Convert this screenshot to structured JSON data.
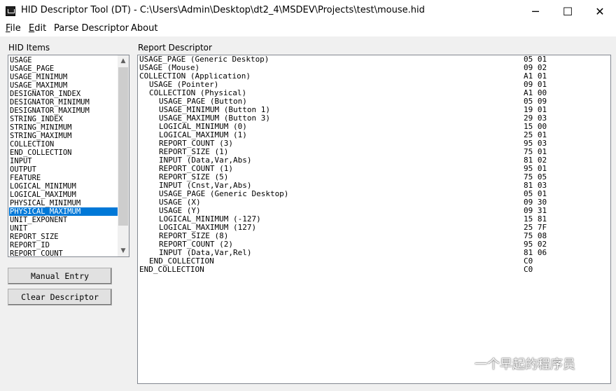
{
  "window": {
    "title": "HID Descriptor Tool (DT) - C:\\Users\\Admin\\Desktop\\dt2_4\\MSDEV\\Projects\\test\\mouse.hid",
    "icon": "app-icon",
    "controls": {
      "minimize": "─",
      "maximize": "☐",
      "close": "✕"
    }
  },
  "menu": [
    {
      "accel": "F",
      "rest": "ile"
    },
    {
      "accel": "E",
      "rest": "dit"
    },
    {
      "accel": "",
      "rest": "Parse Descriptor"
    },
    {
      "accel": "",
      "rest": "About"
    }
  ],
  "hid_items": {
    "label": "HID Items",
    "items": [
      "USAGE",
      "USAGE_PAGE",
      "USAGE_MINIMUM",
      "USAGE_MAXIMUM",
      "DESIGNATOR_INDEX",
      "DESIGNATOR_MINIMUM",
      "DESIGNATOR_MAXIMUM",
      "STRING_INDEX",
      "STRING_MINIMUM",
      "STRING_MAXIMUM",
      "COLLECTION",
      "END_COLLECTION",
      "INPUT",
      "OUTPUT",
      "FEATURE",
      "LOGICAL_MINIMUM",
      "LOGICAL_MAXIMUM",
      "PHYSICAL_MINIMUM",
      "PHYSICAL_MAXIMUM",
      "UNIT_EXPONENT",
      "UNIT",
      "REPORT_SIZE",
      "REPORT_ID",
      "REPORT_COUNT"
    ],
    "selected": "PHYSICAL_MAXIMUM",
    "scroll_up": "▲",
    "scroll_down": "▼"
  },
  "buttons": {
    "manual_entry": "Manual Entry",
    "clear_descriptor": "Clear Descriptor"
  },
  "report": {
    "label": "Report Descriptor",
    "lines": [
      {
        "text": "USAGE_PAGE (Generic Desktop)",
        "indent": 0,
        "hex": "05 01"
      },
      {
        "text": "USAGE (Mouse)",
        "indent": 0,
        "hex": "09 02"
      },
      {
        "text": "COLLECTION (Application)",
        "indent": 0,
        "hex": "A1 01"
      },
      {
        "text": "USAGE (Pointer)",
        "indent": 1,
        "hex": "09 01"
      },
      {
        "text": "COLLECTION (Physical)",
        "indent": 1,
        "hex": "A1 00"
      },
      {
        "text": "USAGE_PAGE (Button)",
        "indent": 2,
        "hex": "05 09"
      },
      {
        "text": "USAGE_MINIMUM (Button 1)",
        "indent": 2,
        "hex": "19 01"
      },
      {
        "text": "USAGE_MAXIMUM (Button 3)",
        "indent": 2,
        "hex": "29 03"
      },
      {
        "text": "LOGICAL_MINIMUM (0)",
        "indent": 2,
        "hex": "15 00"
      },
      {
        "text": "LOGICAL_MAXIMUM (1)",
        "indent": 2,
        "hex": "25 01"
      },
      {
        "text": "REPORT_COUNT (3)",
        "indent": 2,
        "hex": "95 03"
      },
      {
        "text": "REPORT_SIZE (1)",
        "indent": 2,
        "hex": "75 01"
      },
      {
        "text": "INPUT (Data,Var,Abs)",
        "indent": 2,
        "hex": "81 02"
      },
      {
        "text": "REPORT_COUNT (1)",
        "indent": 2,
        "hex": "95 01"
      },
      {
        "text": "REPORT_SIZE (5)",
        "indent": 2,
        "hex": "75 05"
      },
      {
        "text": "INPUT (Cnst,Var,Abs)",
        "indent": 2,
        "hex": "81 03"
      },
      {
        "text": "USAGE_PAGE (Generic Desktop)",
        "indent": 2,
        "hex": "05 01"
      },
      {
        "text": "USAGE (X)",
        "indent": 2,
        "hex": "09 30"
      },
      {
        "text": "USAGE (Y)",
        "indent": 2,
        "hex": "09 31"
      },
      {
        "text": "LOGICAL_MINIMUM (-127)",
        "indent": 2,
        "hex": "15 81"
      },
      {
        "text": "LOGICAL_MAXIMUM (127)",
        "indent": 2,
        "hex": "25 7F"
      },
      {
        "text": "REPORT_SIZE (8)",
        "indent": 2,
        "hex": "75 08"
      },
      {
        "text": "REPORT_COUNT (2)",
        "indent": 2,
        "hex": "95 02"
      },
      {
        "text": "INPUT (Data,Var,Rel)",
        "indent": 2,
        "hex": "81 06"
      },
      {
        "text": "END_COLLECTION",
        "indent": 1,
        "hex": "C0"
      },
      {
        "text": "END_COLLECTION",
        "indent": 0,
        "hex": "C0"
      }
    ]
  },
  "watermark": {
    "text": "一个早起的程序员",
    "icon": "wechat-logo-icon"
  },
  "colors": {
    "selection": "#0078d7",
    "background": "#f0f0f0"
  }
}
